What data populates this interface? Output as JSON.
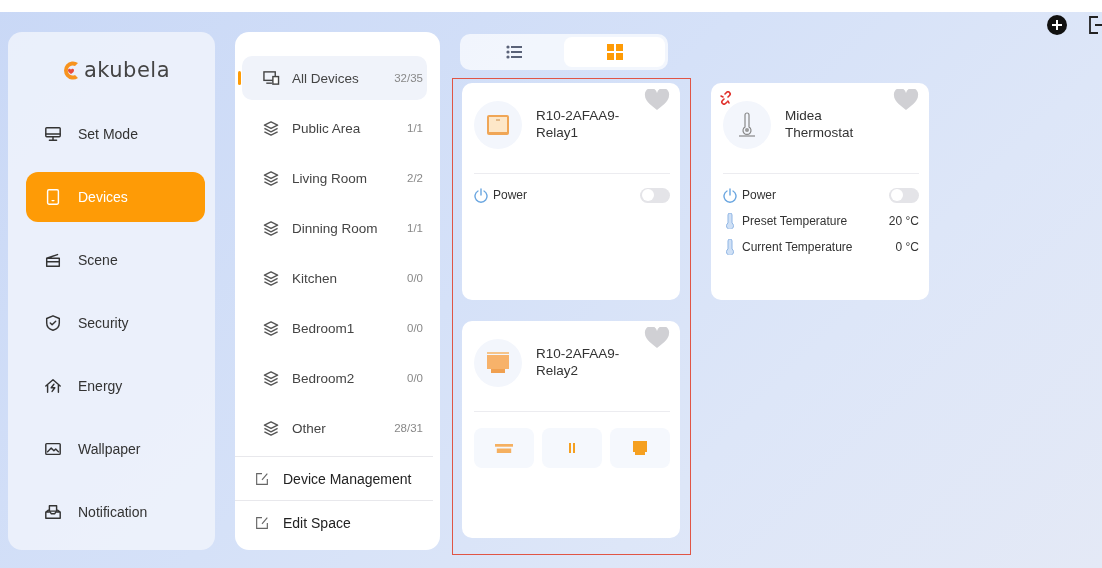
{
  "top_actions": [
    {
      "kind": "add"
    },
    {
      "kind": "logout"
    }
  ],
  "sidebar": {
    "brand": "akubela",
    "items": [
      {
        "label": "Set Mode",
        "kind": "monitor",
        "selected": false
      },
      {
        "label": "Devices",
        "kind": "tablet",
        "selected": true
      },
      {
        "label": "Scene",
        "kind": "clapper",
        "selected": false
      },
      {
        "label": "Security",
        "kind": "shield",
        "selected": false
      },
      {
        "label": "Energy",
        "kind": "energy",
        "selected": false
      },
      {
        "label": "Wallpaper",
        "kind": "picture",
        "selected": false
      },
      {
        "label": "Notification",
        "kind": "inbox",
        "selected": false
      }
    ]
  },
  "spaces": {
    "items": [
      {
        "label": "All Devices",
        "count": "32/35",
        "kind": "all",
        "selected": true
      },
      {
        "label": "Public Area",
        "count": "1/1",
        "kind": "room",
        "selected": false
      },
      {
        "label": "Living Room",
        "count": "2/2",
        "kind": "room",
        "selected": false
      },
      {
        "label": "Dinning Room",
        "count": "1/1",
        "kind": "room",
        "selected": false
      },
      {
        "label": "Kitchen",
        "count": "0/0",
        "kind": "room",
        "selected": false
      },
      {
        "label": "Bedroom1",
        "count": "0/0",
        "kind": "room",
        "selected": false
      },
      {
        "label": "Bedroom2",
        "count": "0/0",
        "kind": "room",
        "selected": false
      },
      {
        "label": "Other",
        "count": "28/31",
        "kind": "room",
        "selected": false
      }
    ],
    "actions": [
      "Device Management",
      "Edit Space"
    ]
  },
  "view_toggle": [
    {
      "kind": "list",
      "selected": false
    },
    {
      "kind": "grid",
      "selected": true
    }
  ],
  "device_columns": [
    {
      "highlighted": true,
      "devices": [
        {
          "name": "R10-2AFAA9-Relay1",
          "kind": "relay",
          "favorite": false,
          "offline": false,
          "controls": [
            {
              "kind": "switch",
              "label": "Power",
              "on": false
            }
          ]
        },
        {
          "name": "R10-2AFAA9-Relay2",
          "kind": "curtain",
          "favorite": false,
          "offline": false,
          "controls": [
            {
              "kind": "curtain"
            }
          ]
        }
      ]
    },
    {
      "highlighted": false,
      "devices": [
        {
          "name": "Midea Thermostat",
          "kind": "thermostat",
          "favorite": false,
          "offline": true,
          "controls": [
            {
              "kind": "switch",
              "label": "Power",
              "on": false
            },
            {
              "kind": "value",
              "label": "Preset Temperature",
              "value": "20 °C"
            },
            {
              "kind": "value",
              "label": "Current Temperature",
              "value": "0 °C"
            }
          ]
        }
      ]
    }
  ]
}
